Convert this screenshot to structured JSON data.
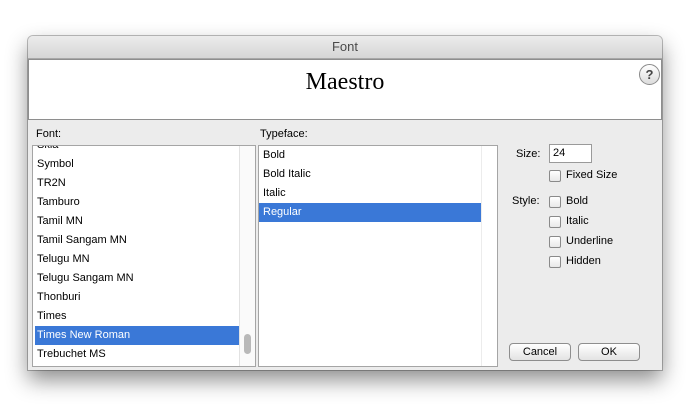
{
  "window": {
    "title": "Font"
  },
  "preview": {
    "text": "Maestro",
    "help": "?"
  },
  "font_panel": {
    "label": "Font:",
    "items": [
      "Skia",
      "Symbol",
      "TR2N",
      "Tamburo",
      "Tamil MN",
      "Tamil Sangam MN",
      "Telugu MN",
      "Telugu Sangam MN",
      "Thonburi",
      "Times",
      "Times New Roman",
      "Trebuchet MS"
    ],
    "selected": "Times New Roman"
  },
  "typeface_panel": {
    "label": "Typeface:",
    "items": [
      "Bold",
      "Bold Italic",
      "Italic",
      "Regular"
    ],
    "selected": "Regular"
  },
  "size": {
    "label": "Size:",
    "value": "24",
    "fixed_size_label": "Fixed Size",
    "fixed_size_checked": false
  },
  "style": {
    "label": "Style:",
    "options": [
      {
        "label": "Bold",
        "checked": false
      },
      {
        "label": "Italic",
        "checked": false
      },
      {
        "label": "Underline",
        "checked": false
      },
      {
        "label": "Hidden",
        "checked": false
      }
    ]
  },
  "buttons": {
    "cancel": "Cancel",
    "ok": "OK"
  },
  "colors": {
    "selection": "#3a78d7",
    "window_bg": "#ececec"
  }
}
